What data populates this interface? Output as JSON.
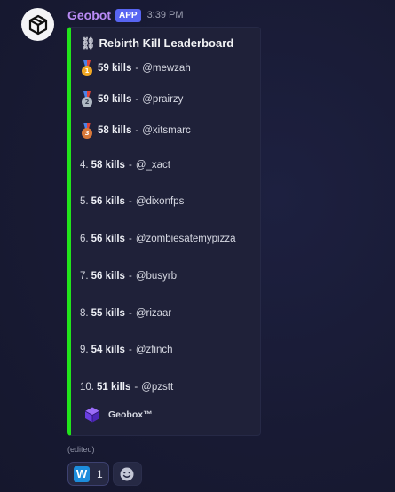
{
  "message": {
    "username": "Geobot",
    "app_badge": "APP",
    "timestamp": "3:39 PM",
    "avatar_icon": "geobot-logo-icon",
    "edited_label": "(edited)"
  },
  "embed": {
    "accent_color": "#21e41b",
    "title_icon": "chain-icon",
    "title_glyph": "⛓",
    "title": "Rebirth Kill Leaderboard",
    "entries": [
      {
        "rank": "",
        "medal": "gold",
        "medal_label": "1",
        "kills": "59 kills",
        "sep": "-",
        "user": "@mewzah"
      },
      {
        "rank": "",
        "medal": "silver",
        "medal_label": "2",
        "kills": "59 kills",
        "sep": "-",
        "user": "@prairzy"
      },
      {
        "rank": "",
        "medal": "bronze",
        "medal_label": "3",
        "kills": "58 kills",
        "sep": "-",
        "user": "@xitsmarc"
      },
      {
        "rank": "4.",
        "kills": "58 kills",
        "sep": "-",
        "user": "@_xact"
      },
      {
        "rank": "5.",
        "kills": "56 kills",
        "sep": "-",
        "user": "@dixonfps"
      },
      {
        "rank": "6.",
        "kills": "56 kills",
        "sep": "-",
        "user": "@zombiesatemypizza"
      },
      {
        "rank": "7.",
        "kills": "56 kills",
        "sep": "-",
        "user": "@busyrb"
      },
      {
        "rank": "8.",
        "kills": "55 kills",
        "sep": "-",
        "user": "@rizaar"
      },
      {
        "rank": "9.",
        "kills": "54 kills",
        "sep": "-",
        "user": "@zfinch"
      },
      {
        "rank": "10.",
        "kills": "51 kills",
        "sep": "-",
        "user": "@pzstt"
      }
    ],
    "footer_icon": "geobox-cube-icon",
    "footer_text": "Geobox™"
  },
  "reactions": [
    {
      "emoji_icon": "w-letter-icon",
      "emoji_text": "W",
      "count": "1"
    },
    {
      "emoji_icon": "add-reaction-icon"
    }
  ]
}
